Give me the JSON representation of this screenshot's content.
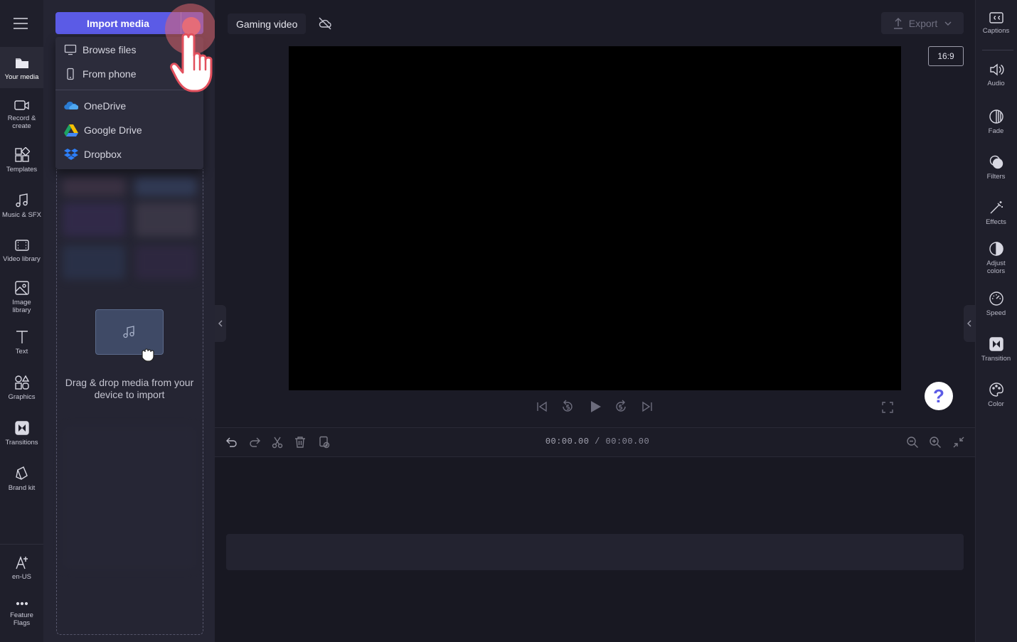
{
  "left_nav": {
    "menu_icon": "hamburger-icon",
    "items": [
      {
        "label": "Your media",
        "icon": "folder-icon",
        "active": true
      },
      {
        "label": "Record &\ncreate",
        "icon": "camera-icon"
      },
      {
        "label": "Templates",
        "icon": "templates-icon"
      },
      {
        "label": "Music & SFX",
        "icon": "music-icon"
      },
      {
        "label": "Video library",
        "icon": "film-icon"
      },
      {
        "label": "Image\nlibrary",
        "icon": "image-icon"
      },
      {
        "label": "Text",
        "icon": "text-icon"
      },
      {
        "label": "Graphics",
        "icon": "shapes-icon"
      },
      {
        "label": "Transitions",
        "icon": "transition-icon"
      },
      {
        "label": "Brand kit",
        "icon": "brand-icon"
      }
    ],
    "bottom": [
      {
        "label": "en-US",
        "icon": "language-icon"
      },
      {
        "label": "Feature\nFlags",
        "icon": "more-icon"
      }
    ]
  },
  "media_panel": {
    "import_label": "Import media",
    "dropdown": {
      "local": [
        {
          "label": "Browse files",
          "icon": "monitor-icon"
        },
        {
          "label": "From phone",
          "icon": "phone-icon"
        }
      ],
      "cloud": [
        {
          "label": "OneDrive",
          "icon": "onedrive-icon"
        },
        {
          "label": "Google Drive",
          "icon": "google-drive-icon"
        },
        {
          "label": "Dropbox",
          "icon": "dropbox-icon"
        }
      ]
    },
    "drop_text": "Drag & drop media from your device to import"
  },
  "topbar": {
    "project_title": "Gaming video",
    "cloud_status_icon": "cloud-off-icon",
    "export_label": "Export"
  },
  "preview": {
    "aspect_ratio": "16:9",
    "help_label": "?"
  },
  "timeline": {
    "current_time": "00:00.00",
    "separator": " / ",
    "total_time": "00:00.00"
  },
  "right_panel": {
    "items": [
      {
        "label": "Captions",
        "icon": "captions-icon"
      },
      {
        "label": "Audio",
        "icon": "speaker-icon"
      },
      {
        "label": "Fade",
        "icon": "fade-icon"
      },
      {
        "label": "Filters",
        "icon": "filters-icon"
      },
      {
        "label": "Effects",
        "icon": "magic-wand-icon"
      },
      {
        "label": "Adjust\ncolors",
        "icon": "contrast-icon"
      },
      {
        "label": "Speed",
        "icon": "speedometer-icon"
      },
      {
        "label": "Transition",
        "icon": "transition-icon"
      },
      {
        "label": "Color",
        "icon": "palette-icon"
      }
    ]
  },
  "colors": {
    "accent": "#5b5be6",
    "background": "#1b1b26",
    "highlight": "#e0646e"
  }
}
